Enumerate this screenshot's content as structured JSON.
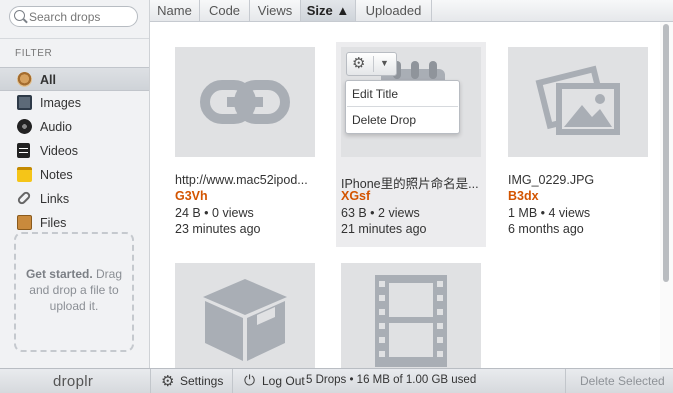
{
  "search": {
    "placeholder": "Search drops"
  },
  "sidebar": {
    "filter_heading": "FILTER",
    "items": [
      {
        "label": "All",
        "icon": "all-icon",
        "active": true
      },
      {
        "label": "Images",
        "icon": "image-icon"
      },
      {
        "label": "Audio",
        "icon": "audio-icon"
      },
      {
        "label": "Videos",
        "icon": "video-icon"
      },
      {
        "label": "Notes",
        "icon": "note-icon"
      },
      {
        "label": "Links",
        "icon": "link-icon"
      },
      {
        "label": "Files",
        "icon": "file-icon"
      }
    ],
    "dropzone_bold": "Get started.",
    "dropzone_text": "Drag and drop a file to upload it."
  },
  "columns": [
    {
      "label": "Name"
    },
    {
      "label": "Code"
    },
    {
      "label": "Views"
    },
    {
      "label": "Size ▲",
      "active": true
    },
    {
      "label": "Uploaded"
    }
  ],
  "drops": [
    {
      "name": "http://www.mac52ipod...",
      "code": "G3Vh",
      "meta": "24 B • 0 views",
      "time": "23 minutes ago",
      "type": "link"
    },
    {
      "name": "IPhone里的照片命名是...",
      "code": "XGsf",
      "meta": "63 B • 2 views",
      "time": "21 minutes ago",
      "type": "note"
    },
    {
      "name": "IMG_0229.JPG",
      "code": "B3dx",
      "meta": "1 MB • 4 views",
      "time": "6 months ago",
      "type": "image"
    },
    {
      "type": "file"
    },
    {
      "type": "video"
    }
  ],
  "context_menu": {
    "items": [
      "Edit Title",
      "Delete Drop"
    ]
  },
  "footer": {
    "logo": "droplr",
    "settings": "Settings",
    "logout": "Log Out",
    "usage": "5 Drops • 16 MB of 1.00 GB used",
    "delete_selected": "Delete Selected"
  },
  "colors": {
    "accent": "#d35400",
    "thumb_bg": "#e0e1e3",
    "thumb_icon": "#a9aeb5"
  }
}
